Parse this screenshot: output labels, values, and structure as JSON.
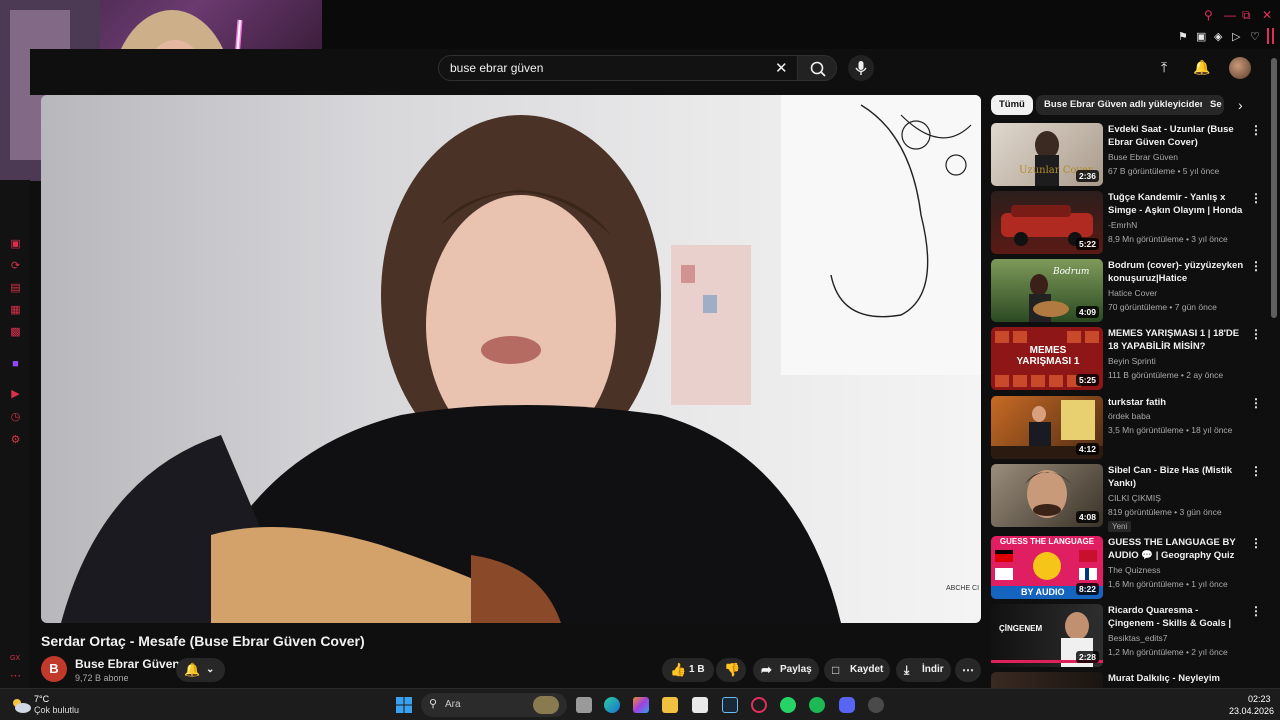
{
  "search": {
    "query": "buse ebrar güven"
  },
  "video": {
    "title": "Serdar Ortaç - Mesafe (Buse Ebrar Güven Cover)",
    "watermark": "ABCHE CI"
  },
  "channel": {
    "avatar_letter": "B",
    "name": "Buse Ebrar Güven",
    "subscribers": "9,72 B abone"
  },
  "actions": {
    "likes": "1 B",
    "share": "Paylaş",
    "save": "Kaydet",
    "download": "İndir"
  },
  "chips": [
    "Tümü",
    "Buse Ebrar Güven adlı yükleyiciden",
    "Se"
  ],
  "recommendations": [
    {
      "title": "Evdeki Saat - Uzunlar (Buse Ebrar Güven Cover)",
      "channel": "Buse Ebrar Güven",
      "meta": "67 B görüntüleme • 5 yıl önce",
      "duration": "2:36",
      "thumb_text": "Uzunlar Cover",
      "colors": [
        "#d9d2c9",
        "#a89c8e"
      ]
    },
    {
      "title": "Tuğçe Kandemir - Yanlış x Simge - Aşkın Olayım | Honda ...",
      "channel": "-EmrhN",
      "meta": "8,9 Mn görüntüleme • 3 yıl önce",
      "duration": "5:22",
      "thumb_text": "",
      "colors": [
        "#2a1c1a",
        "#8a2a22"
      ]
    },
    {
      "title": "Bodrum (cover)- yüzyüzeyken konuşuruz|Hatice",
      "channel": "Hatice Cover",
      "meta": "70 görüntüleme • 7 gün önce",
      "duration": "4:09",
      "thumb_text": "Bodrum",
      "colors": [
        "#5a7a3a",
        "#2c4a22"
      ]
    },
    {
      "title": "MEMES YARIŞMASI 1 | 18'DE 18 YAPABİLİR MİSİN?",
      "channel": "Beyin Sprinti",
      "meta": "111 B görüntüleme • 2 ay önce",
      "duration": "5:25",
      "thumb_text": "MEMES YARIŞMASI 1",
      "colors": [
        "#a31a1a",
        "#5a0e0e"
      ]
    },
    {
      "title": "turkstar fatih",
      "channel": "ördek baba",
      "meta": "3,5 Mn görüntüleme • 18 yıl önce",
      "duration": "4:12",
      "thumb_text": "",
      "colors": [
        "#c0561e",
        "#3a2a1a"
      ]
    },
    {
      "title": "Sibel Can - Bize Has (Mistik Yankı)",
      "channel": "CILKI ÇIKMIŞ",
      "meta": "819 görüntüleme • 3 gün önce",
      "duration": "4:08",
      "badge": "Yeni",
      "thumb_text": "",
      "colors": [
        "#8a8070",
        "#3a3228"
      ]
    },
    {
      "title": "GUESS THE LANGUAGE BY AUDIO 💬 | Geography Quiz",
      "channel": "The Quizness",
      "meta": "1,6 Mn görüntüleme • 1 yıl önce",
      "duration": "8:22",
      "thumb_text": "GUESS THE LANGUAGE",
      "thumb_text2": "BY AUDIO",
      "colors": [
        "#e0206a",
        "#d81e5b"
      ]
    },
    {
      "title": "Ricardo Quaresma - Çingenem - Skills & Goals | HD",
      "channel": "Besiktas_edits7",
      "meta": "1,2 Mn görüntüleme • 2 yıl önce",
      "duration": "2:28",
      "thumb_text": "ÇİNGENEM",
      "colors": [
        "#1a1a1a",
        "#3a3a3a"
      ]
    },
    {
      "title": "Murat Dalkılıç - Neyleyim",
      "channel": "",
      "meta": "",
      "duration": "",
      "thumb_text": "",
      "colors": [
        "#3a2a22",
        "#1a1410"
      ]
    }
  ],
  "taskbar": {
    "temperature": "7°C",
    "weather": "Çok bulutlu",
    "search_placeholder": "Ara",
    "time": "02:23",
    "date": "23.04.2026"
  },
  "rail_label": "GX"
}
